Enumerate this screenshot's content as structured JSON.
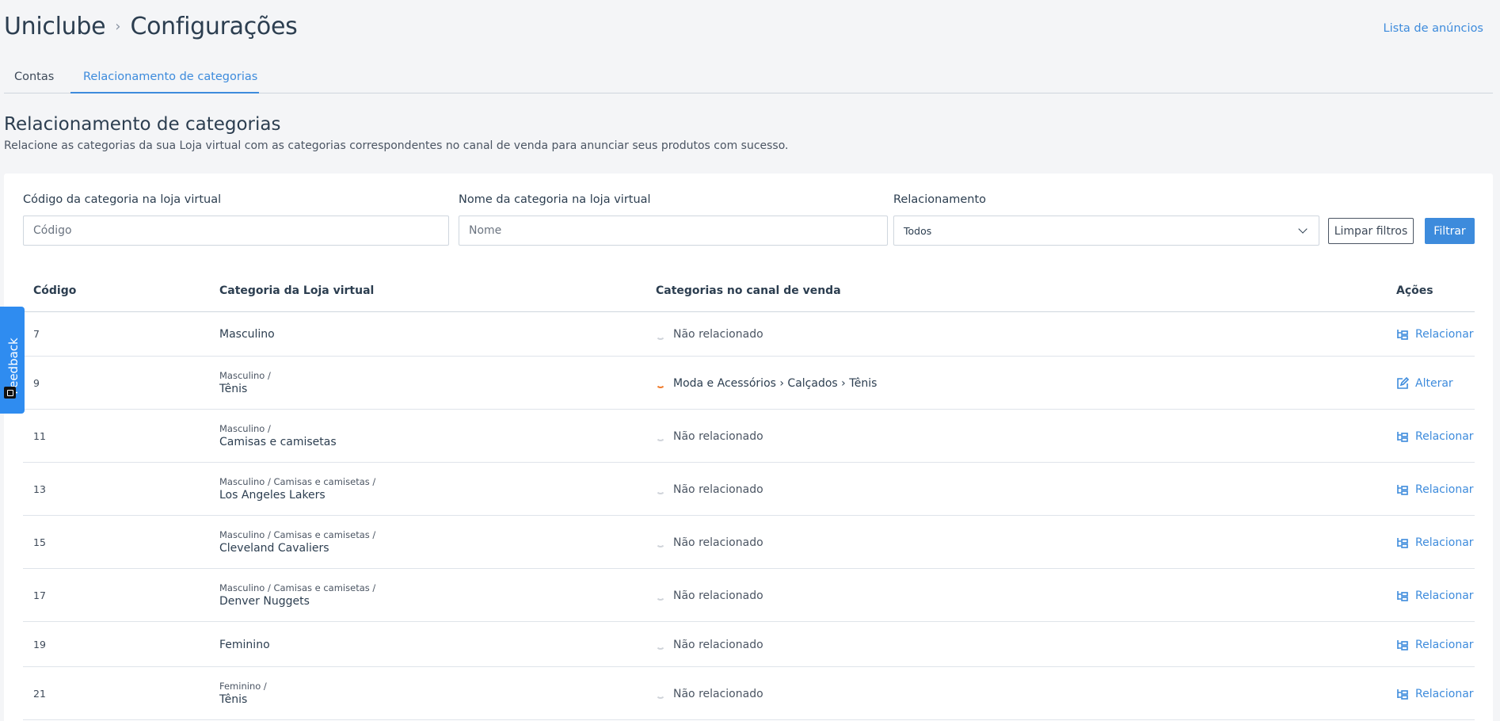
{
  "header": {
    "breadcrumb": [
      "Uniclube",
      "Configurações"
    ],
    "separator": "›",
    "top_link": "Lista de anúncios"
  },
  "tabs": [
    {
      "label": "Contas",
      "active": false
    },
    {
      "label": "Relacionamento de categorias",
      "active": true
    }
  ],
  "section": {
    "title": "Relacionamento de categorias",
    "description": "Relacione as categorias da sua Loja virtual com as categorias correspondentes no canal de venda para anunciar seus produtos com sucesso."
  },
  "filters": {
    "code_label": "Código da categoria na loja virtual",
    "code_placeholder": "Código",
    "name_label": "Nome da categoria na loja virtual",
    "name_placeholder": "Nome",
    "relation_label": "Relacionamento",
    "relation_value": "Todos",
    "clear_label": "Limpar filtros",
    "filter_label": "Filtrar"
  },
  "table": {
    "headers": {
      "code": "Código",
      "store_category": "Categoria da Loja virtual",
      "channel_category": "Categorias no canal de venda",
      "actions": "Ações"
    },
    "rows": [
      {
        "code": "7",
        "parent": "",
        "name": "Masculino",
        "channel": "Não relacionado",
        "related": false,
        "action": "Relacionar"
      },
      {
        "code": "9",
        "parent": "Masculino /",
        "name": "Tênis",
        "channel": "Moda e Acessórios › Calçados › Tênis",
        "related": true,
        "action": "Alterar"
      },
      {
        "code": "11",
        "parent": "Masculino /",
        "name": "Camisas e camisetas",
        "channel": "Não relacionado",
        "related": false,
        "action": "Relacionar"
      },
      {
        "code": "13",
        "parent": "Masculino / Camisas e camisetas /",
        "name": "Los Angeles Lakers",
        "channel": "Não relacionado",
        "related": false,
        "action": "Relacionar"
      },
      {
        "code": "15",
        "parent": "Masculino / Camisas e camisetas /",
        "name": "Cleveland Cavaliers",
        "channel": "Não relacionado",
        "related": false,
        "action": "Relacionar"
      },
      {
        "code": "17",
        "parent": "Masculino / Camisas e camisetas /",
        "name": "Denver Nuggets",
        "channel": "Não relacionado",
        "related": false,
        "action": "Relacionar"
      },
      {
        "code": "19",
        "parent": "",
        "name": "Feminino",
        "channel": "Não relacionado",
        "related": false,
        "action": "Relacionar"
      },
      {
        "code": "21",
        "parent": "Feminino /",
        "name": "Tênis",
        "channel": "Não relacionado",
        "related": false,
        "action": "Relacionar"
      }
    ]
  },
  "feedback": {
    "label": "Feedback"
  },
  "colors": {
    "accent": "#3d8bdc",
    "related": "#f07b2b",
    "feedback": "#2f8cf0"
  }
}
